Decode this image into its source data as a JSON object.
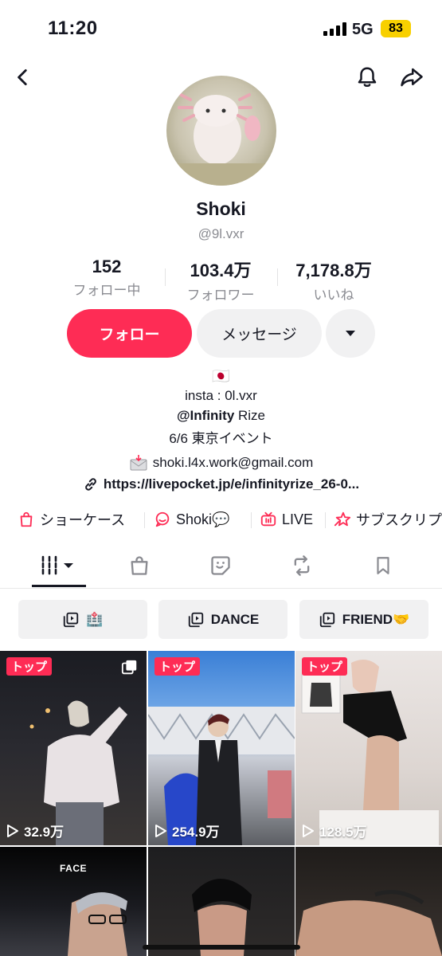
{
  "status_bar": {
    "time": "11:20",
    "network": "5G",
    "battery": "83"
  },
  "profile": {
    "name": "Shoki",
    "handle": "@9l.vxr",
    "stats": [
      {
        "value": "152",
        "label": "フォロー中"
      },
      {
        "value": "103.4万",
        "label": "フォロワー"
      },
      {
        "value": "7,178.8万",
        "label": "いいね"
      }
    ],
    "follow_label": "フォロー",
    "message_label": "メッセージ",
    "bio": {
      "flag": "🇯🇵",
      "line1": "insta : 0l.vxr",
      "line2_mention": "@Infinity",
      "line2_rest": " Rize",
      "line3": "6/6 東京イベント"
    },
    "email": "shoki.l4x.work@gmail.com",
    "link": "https://livepocket.jp/e/infinityrize_26-0..."
  },
  "shortcuts": [
    {
      "label": "ショーケース",
      "icon": "shopping-bag-icon"
    },
    {
      "label": "Shoki💬",
      "icon": "chat-bubble-icon"
    },
    {
      "label": "LIVE",
      "icon": "live-tv-icon"
    },
    {
      "label": "サブスクリプ",
      "icon": "subscription-star-icon"
    }
  ],
  "tabs": [
    "videos-grid-icon",
    "shop-bag-icon",
    "sticker-icon",
    "repost-icon",
    "bookmark-icon"
  ],
  "playlists": [
    {
      "label": "🏥"
    },
    {
      "label": "DANCE"
    },
    {
      "label": "FRIEND🤝"
    }
  ],
  "videos": [
    {
      "badge": "トップ",
      "views": "32.9万"
    },
    {
      "badge": "トップ",
      "views": "254.9万"
    },
    {
      "badge": "トップ",
      "views": "128.5万"
    },
    {
      "overlay_text": "FACE"
    },
    {},
    {}
  ],
  "colors": {
    "accent": "#fe2c55",
    "text": "#161823",
    "muted": "#8a8b91",
    "pill": "#f1f1f2"
  }
}
